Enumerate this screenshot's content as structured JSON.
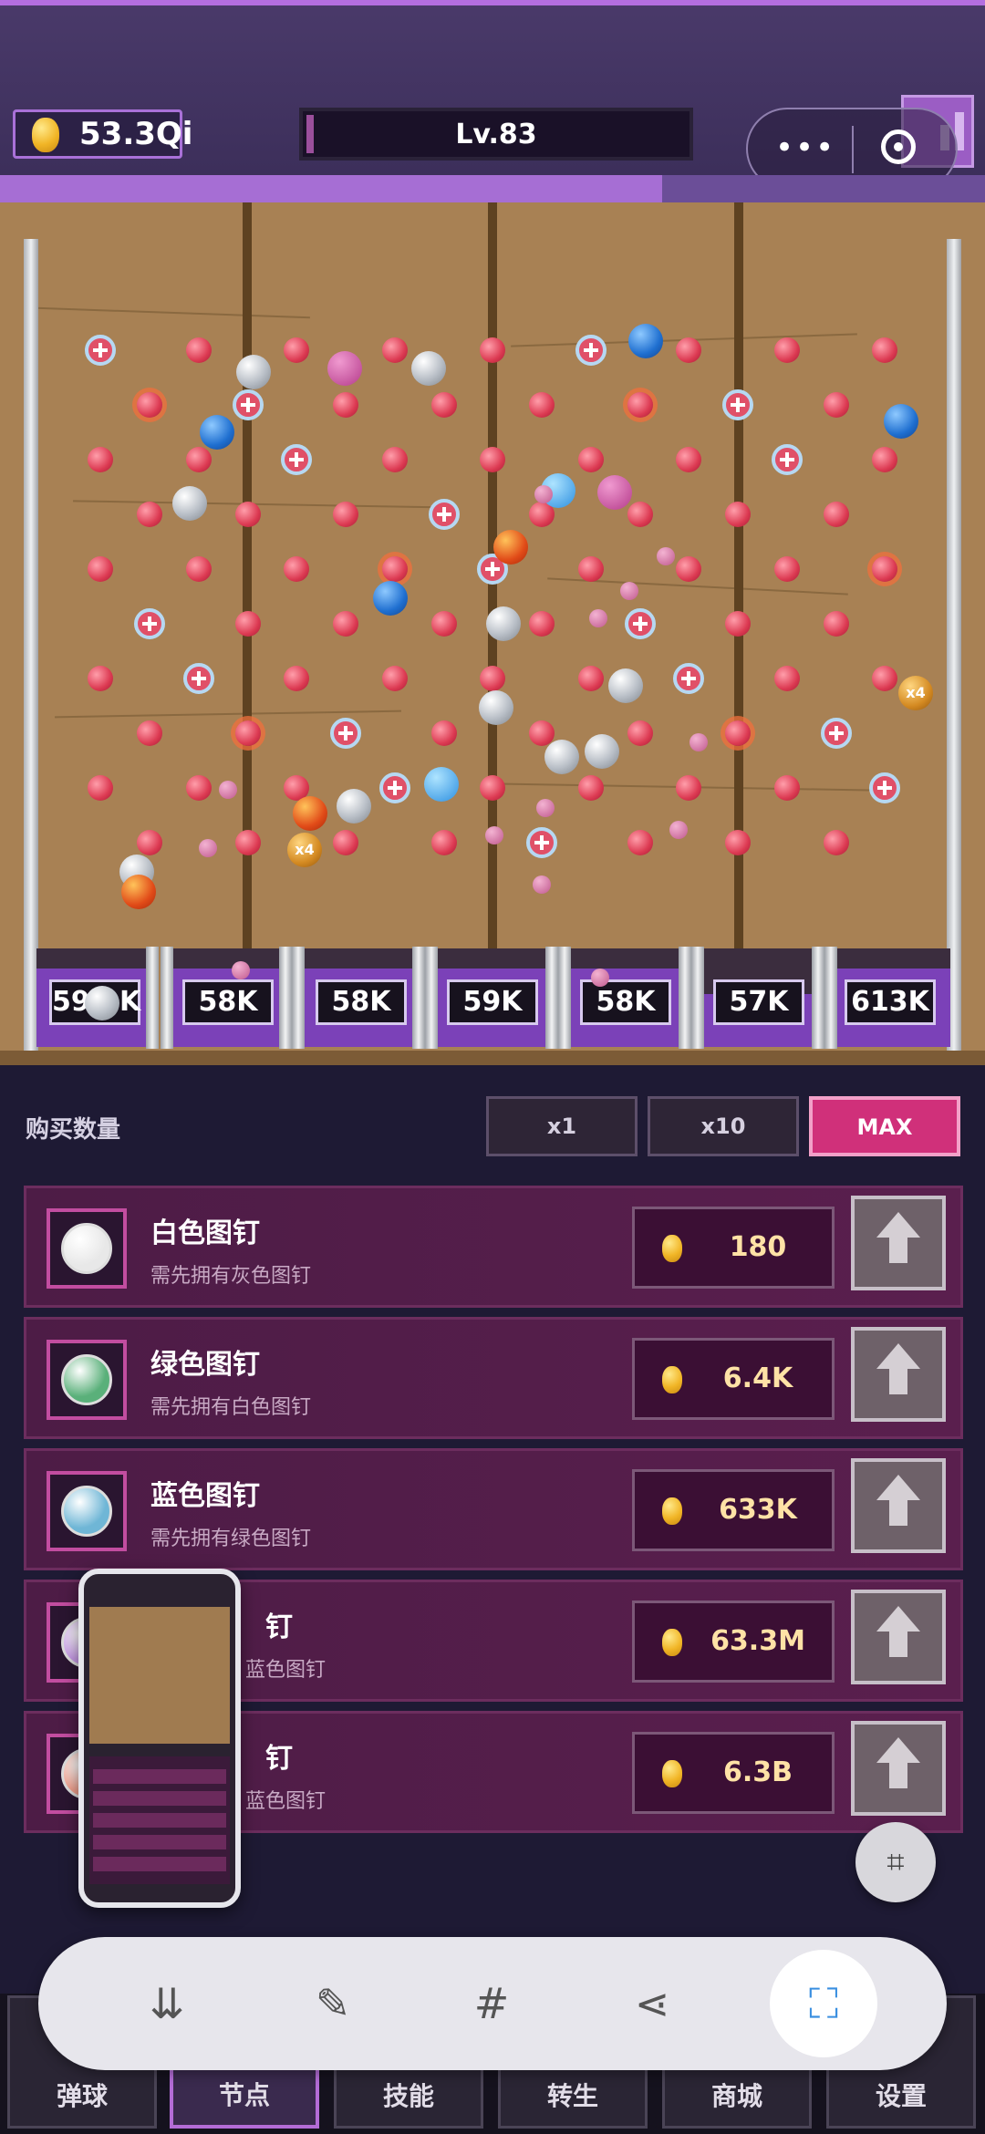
{
  "header": {
    "coins": "53.3Qi",
    "level": "Lv.83",
    "capsule_menu_glyph": "•••"
  },
  "board": {
    "buckets": [
      "59.9K",
      "58K",
      "58K",
      "59K",
      "58K",
      "57K",
      "613K"
    ],
    "ball_labels": {
      "multiplier": "x4"
    }
  },
  "shop": {
    "buy_quantity_label": "购买数量",
    "quantity_options": [
      "x1",
      "x10",
      "MAX"
    ],
    "selected_quantity": "MAX",
    "items": [
      {
        "name": "白色图钉",
        "requirement": "需先拥有灰色图钉",
        "price": "180",
        "color": "#e8e8e8"
      },
      {
        "name": "绿色图钉",
        "requirement": "需先拥有白色图钉",
        "price": "6.4K",
        "color": "#5ab07a"
      },
      {
        "name": "蓝色图钉",
        "requirement": "需先拥有绿色图钉",
        "price": "633K",
        "color": "#6fb6d6"
      },
      {
        "name": "钉",
        "requirement": "蓝色图钉",
        "price": "63.3M",
        "color": "#c79be6"
      },
      {
        "name": "钉",
        "requirement": "蓝色图钉",
        "price": "6.3B",
        "color": "#f0a08e"
      }
    ]
  },
  "toolbar": {
    "icons": [
      "scroll-capture-icon",
      "edit-icon",
      "hashtag-icon",
      "share-icon",
      "fullscreen-capture-icon"
    ]
  },
  "nav": {
    "tabs": [
      {
        "label": "弹球"
      },
      {
        "label": "节点"
      },
      {
        "label": "技能"
      },
      {
        "label": "转生"
      },
      {
        "label": "商城"
      },
      {
        "label": "设置"
      }
    ],
    "active": "节点"
  }
}
